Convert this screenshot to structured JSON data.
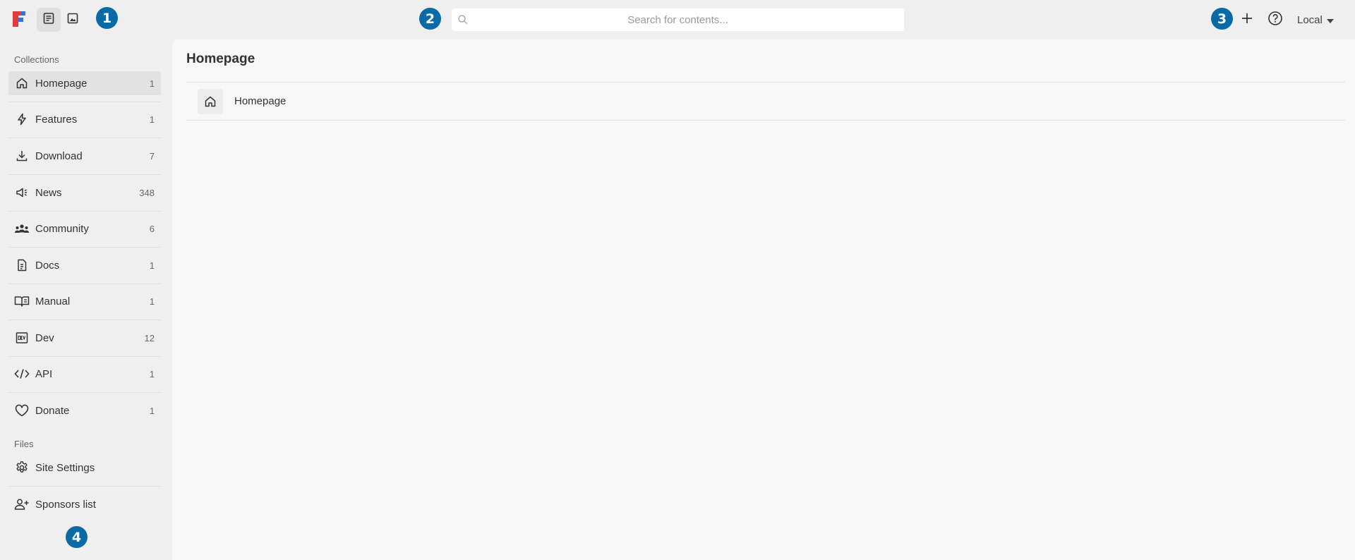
{
  "header": {
    "search_placeholder": "Search for contents...",
    "locale": "Local",
    "badges": [
      "1",
      "2",
      "3"
    ]
  },
  "sidebar": {
    "collections_label": "Collections",
    "files_label": "Files",
    "collections": [
      {
        "label": "Homepage",
        "count": "1",
        "icon": "home-icon"
      },
      {
        "label": "Features",
        "count": "1",
        "icon": "bolt-icon"
      },
      {
        "label": "Download",
        "count": "7",
        "icon": "download-icon"
      },
      {
        "label": "News",
        "count": "348",
        "icon": "megaphone-icon"
      },
      {
        "label": "Community",
        "count": "6",
        "icon": "people-icon"
      },
      {
        "label": "Docs",
        "count": "1",
        "icon": "document-icon"
      },
      {
        "label": "Manual",
        "count": "1",
        "icon": "book-icon"
      },
      {
        "label": "Dev",
        "count": "12",
        "icon": "dev-icon"
      },
      {
        "label": "API",
        "count": "1",
        "icon": "code-icon"
      },
      {
        "label": "Donate",
        "count": "1",
        "icon": "heart-icon"
      }
    ],
    "files": [
      {
        "label": "Site Settings",
        "icon": "gear-icon"
      },
      {
        "label": "Sponsors list",
        "icon": "person-add-icon"
      }
    ],
    "badge": "4"
  },
  "main": {
    "title": "Homepage",
    "entries": [
      {
        "label": "Homepage",
        "icon": "home-icon"
      }
    ]
  },
  "colors": {
    "badge": "#0a6aa6",
    "background": "#efefef",
    "content": "#f8f8f8"
  }
}
